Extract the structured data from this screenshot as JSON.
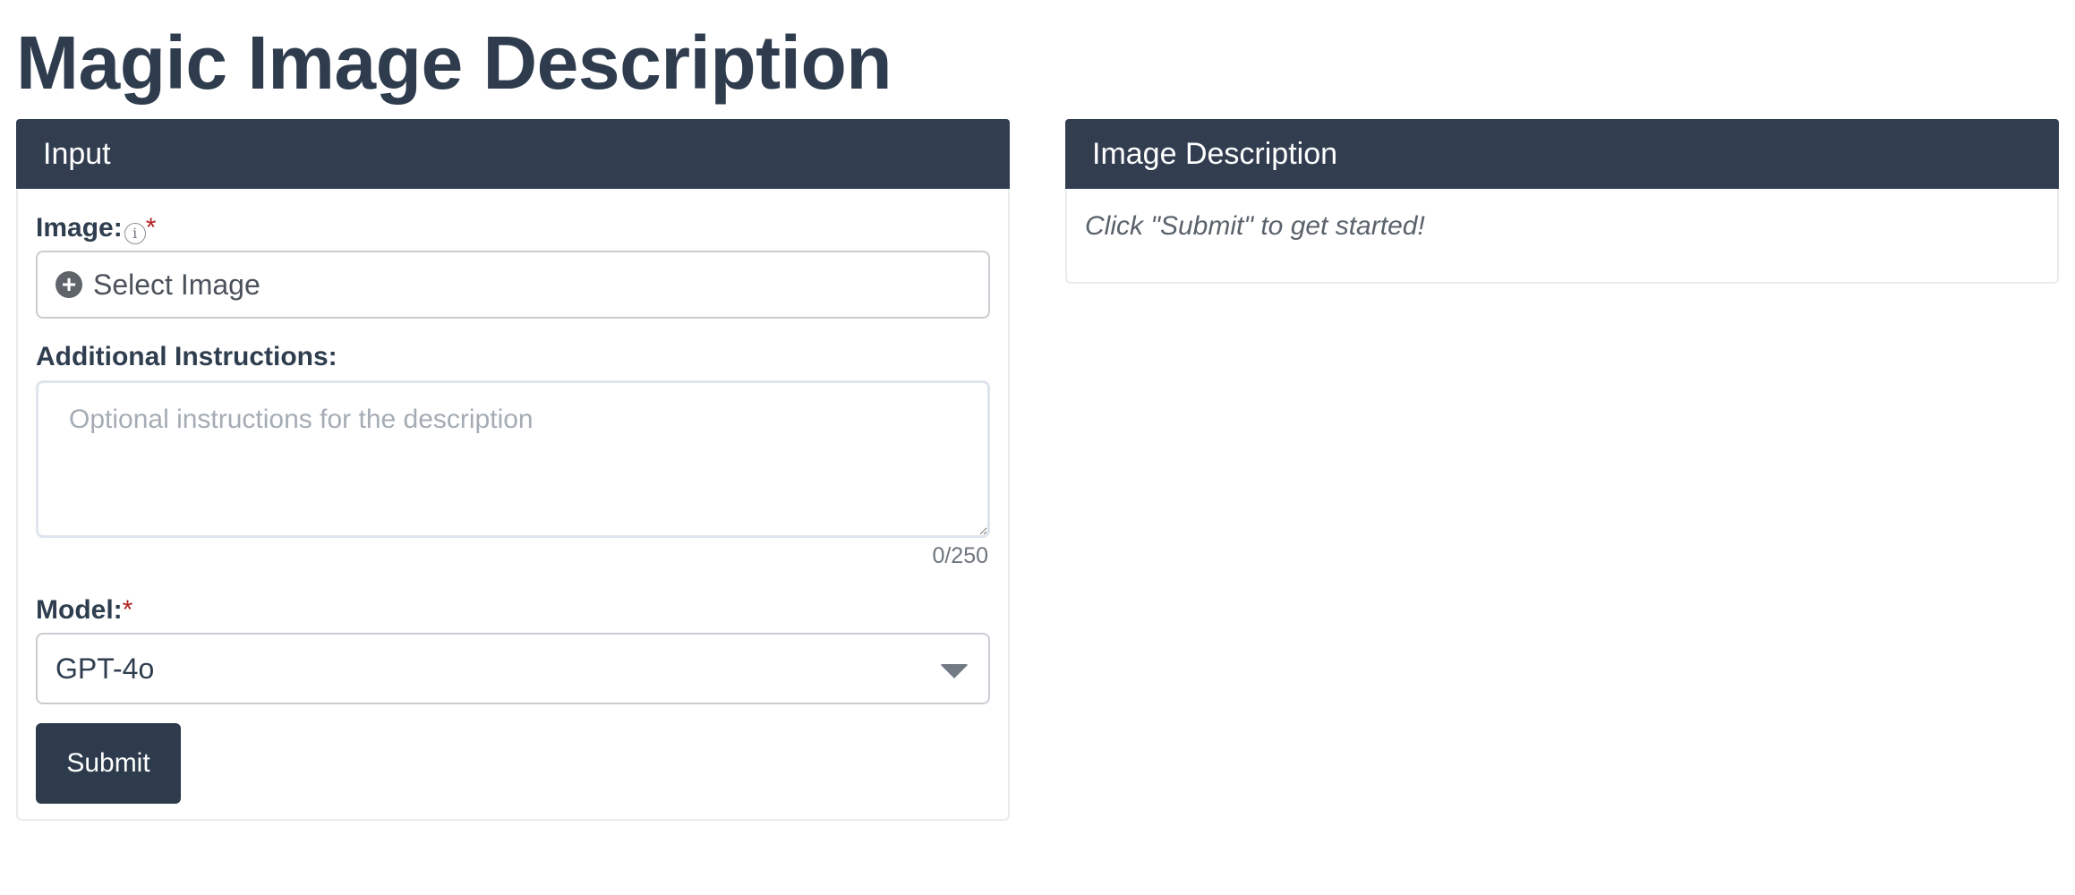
{
  "page": {
    "title": "Magic Image Description"
  },
  "input_panel": {
    "title": "Input",
    "image_label": "Image:",
    "image_required_mark": "*",
    "info_icon_glyph": "i",
    "select_image_label": "Select Image",
    "select_image_icon": "plus-circle-icon",
    "instructions_label": "Additional Instructions:",
    "instructions_value": "",
    "instructions_placeholder": "Optional instructions for the description",
    "char_count": "0/250",
    "model_label": "Model:",
    "model_required_mark": "*",
    "model_value": "GPT-4o",
    "submit_label": "Submit"
  },
  "output_panel": {
    "title": "Image Description",
    "message": "Click \"Submit\" to get started!"
  },
  "colors": {
    "header_bg": "#323e50",
    "title_text": "#2e3c4e",
    "required_mark": "#b22323",
    "button_bg": "#2e3b4d"
  }
}
